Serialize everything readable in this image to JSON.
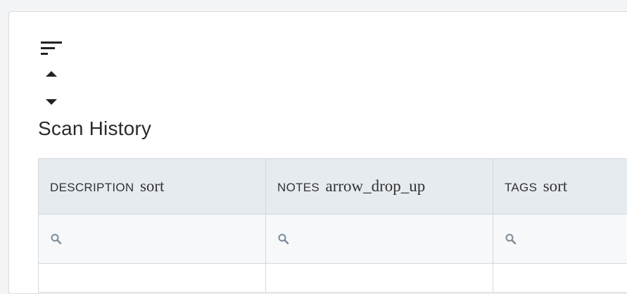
{
  "panel": {
    "title": "Scan History",
    "icons": {
      "sort": "sort-icon",
      "sort_up": "caret-up-icon",
      "sort_down": "caret-down-icon"
    }
  },
  "table": {
    "columns": [
      {
        "label": "DESCRIPTION",
        "icon_text": "sort"
      },
      {
        "label": "NOTES",
        "icon_text": "arrow_drop_up"
      },
      {
        "label": "TAGS",
        "icon_text": "sort"
      }
    ],
    "filters": [
      {
        "value": "",
        "placeholder": ""
      },
      {
        "value": "",
        "placeholder": ""
      },
      {
        "value": "",
        "placeholder": ""
      }
    ],
    "filter_icon": "search-icon"
  },
  "colors": {
    "header_bg": "#e6ebf0",
    "filter_bg": "#f6f8f9",
    "border": "#d3d8de",
    "icon": "#7c8a99"
  }
}
